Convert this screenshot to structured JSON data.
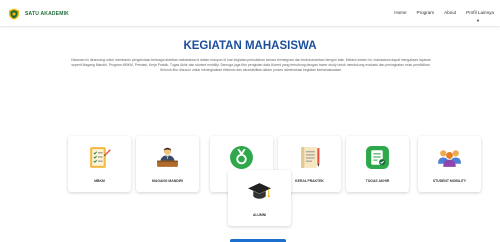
{
  "brand": {
    "name": "SATU AKADEMIK"
  },
  "nav": {
    "items": [
      "Home",
      "Program",
      "About",
      "Profil Lainnya"
    ]
  },
  "main": {
    "title": "KEGIATAN MAHASISWA",
    "intro": "Halaman ini dirancang untuk membantu pengelolaan berbagai aktivitas mahasiswa di dalam maupun di luar kegiatan perkuliahan secara terintegrasi dan terdokumentasi dengan baik. Melalui sistem ini, mahasiswa dapat mengakses layanan seperti Magang Mandiri, Program MBKM, Prestasi, Kerja Praktik, Tugas Akhir dan student mobility. Semoga juga fitur pengisian data Alumni yang terhubung dengan tracer study untuk mendukung evaluasi dan peningkatan mutu pendidikan. Seluruh fitur disusun untuk meningkatkan efisiensi dan akuntabilitas dalam proses administrasi kegiatan kemahasiswaan."
  },
  "cards": [
    {
      "label": "MBKM",
      "icon": "checklist-icon"
    },
    {
      "label": "MAGANG MANDIRI",
      "icon": "office-worker-icon"
    },
    {
      "label": "PRESTASI",
      "icon": "medal-icon"
    },
    {
      "label": "KERJA PRAKTEK",
      "icon": "notebook-icon"
    },
    {
      "label": "TUGAS AKHIR",
      "icon": "document-icon"
    },
    {
      "label": "STUDENT MOBILITY",
      "icon": "people-group-icon"
    },
    {
      "label": "ALUMNI",
      "icon": "graduation-cap-icon"
    }
  ],
  "colors": {
    "brand": "#1e6b3a",
    "title": "#1b4f9c",
    "button": "#1a6fcf"
  }
}
